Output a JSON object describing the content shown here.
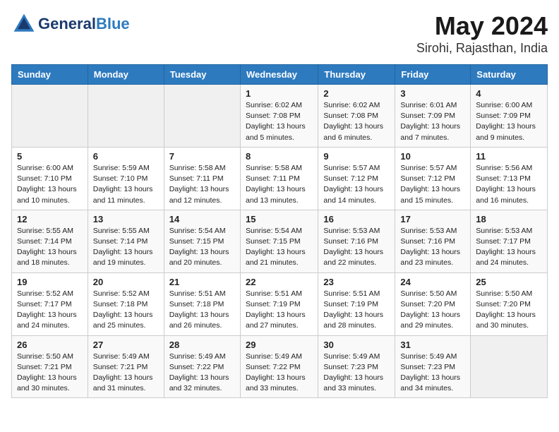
{
  "header": {
    "logo_general": "General",
    "logo_blue": "Blue",
    "month": "May 2024",
    "location": "Sirohi, Rajasthan, India"
  },
  "weekdays": [
    "Sunday",
    "Monday",
    "Tuesday",
    "Wednesday",
    "Thursday",
    "Friday",
    "Saturday"
  ],
  "weeks": [
    [
      {
        "day": "",
        "info": ""
      },
      {
        "day": "",
        "info": ""
      },
      {
        "day": "",
        "info": ""
      },
      {
        "day": "1",
        "info": "Sunrise: 6:02 AM\nSunset: 7:08 PM\nDaylight: 13 hours and 5 minutes."
      },
      {
        "day": "2",
        "info": "Sunrise: 6:02 AM\nSunset: 7:08 PM\nDaylight: 13 hours and 6 minutes."
      },
      {
        "day": "3",
        "info": "Sunrise: 6:01 AM\nSunset: 7:09 PM\nDaylight: 13 hours and 7 minutes."
      },
      {
        "day": "4",
        "info": "Sunrise: 6:00 AM\nSunset: 7:09 PM\nDaylight: 13 hours and 9 minutes."
      }
    ],
    [
      {
        "day": "5",
        "info": "Sunrise: 6:00 AM\nSunset: 7:10 PM\nDaylight: 13 hours and 10 minutes."
      },
      {
        "day": "6",
        "info": "Sunrise: 5:59 AM\nSunset: 7:10 PM\nDaylight: 13 hours and 11 minutes."
      },
      {
        "day": "7",
        "info": "Sunrise: 5:58 AM\nSunset: 7:11 PM\nDaylight: 13 hours and 12 minutes."
      },
      {
        "day": "8",
        "info": "Sunrise: 5:58 AM\nSunset: 7:11 PM\nDaylight: 13 hours and 13 minutes."
      },
      {
        "day": "9",
        "info": "Sunrise: 5:57 AM\nSunset: 7:12 PM\nDaylight: 13 hours and 14 minutes."
      },
      {
        "day": "10",
        "info": "Sunrise: 5:57 AM\nSunset: 7:12 PM\nDaylight: 13 hours and 15 minutes."
      },
      {
        "day": "11",
        "info": "Sunrise: 5:56 AM\nSunset: 7:13 PM\nDaylight: 13 hours and 16 minutes."
      }
    ],
    [
      {
        "day": "12",
        "info": "Sunrise: 5:55 AM\nSunset: 7:14 PM\nDaylight: 13 hours and 18 minutes."
      },
      {
        "day": "13",
        "info": "Sunrise: 5:55 AM\nSunset: 7:14 PM\nDaylight: 13 hours and 19 minutes."
      },
      {
        "day": "14",
        "info": "Sunrise: 5:54 AM\nSunset: 7:15 PM\nDaylight: 13 hours and 20 minutes."
      },
      {
        "day": "15",
        "info": "Sunrise: 5:54 AM\nSunset: 7:15 PM\nDaylight: 13 hours and 21 minutes."
      },
      {
        "day": "16",
        "info": "Sunrise: 5:53 AM\nSunset: 7:16 PM\nDaylight: 13 hours and 22 minutes."
      },
      {
        "day": "17",
        "info": "Sunrise: 5:53 AM\nSunset: 7:16 PM\nDaylight: 13 hours and 23 minutes."
      },
      {
        "day": "18",
        "info": "Sunrise: 5:53 AM\nSunset: 7:17 PM\nDaylight: 13 hours and 24 minutes."
      }
    ],
    [
      {
        "day": "19",
        "info": "Sunrise: 5:52 AM\nSunset: 7:17 PM\nDaylight: 13 hours and 24 minutes."
      },
      {
        "day": "20",
        "info": "Sunrise: 5:52 AM\nSunset: 7:18 PM\nDaylight: 13 hours and 25 minutes."
      },
      {
        "day": "21",
        "info": "Sunrise: 5:51 AM\nSunset: 7:18 PM\nDaylight: 13 hours and 26 minutes."
      },
      {
        "day": "22",
        "info": "Sunrise: 5:51 AM\nSunset: 7:19 PM\nDaylight: 13 hours and 27 minutes."
      },
      {
        "day": "23",
        "info": "Sunrise: 5:51 AM\nSunset: 7:19 PM\nDaylight: 13 hours and 28 minutes."
      },
      {
        "day": "24",
        "info": "Sunrise: 5:50 AM\nSunset: 7:20 PM\nDaylight: 13 hours and 29 minutes."
      },
      {
        "day": "25",
        "info": "Sunrise: 5:50 AM\nSunset: 7:20 PM\nDaylight: 13 hours and 30 minutes."
      }
    ],
    [
      {
        "day": "26",
        "info": "Sunrise: 5:50 AM\nSunset: 7:21 PM\nDaylight: 13 hours and 30 minutes."
      },
      {
        "day": "27",
        "info": "Sunrise: 5:49 AM\nSunset: 7:21 PM\nDaylight: 13 hours and 31 minutes."
      },
      {
        "day": "28",
        "info": "Sunrise: 5:49 AM\nSunset: 7:22 PM\nDaylight: 13 hours and 32 minutes."
      },
      {
        "day": "29",
        "info": "Sunrise: 5:49 AM\nSunset: 7:22 PM\nDaylight: 13 hours and 33 minutes."
      },
      {
        "day": "30",
        "info": "Sunrise: 5:49 AM\nSunset: 7:23 PM\nDaylight: 13 hours and 33 minutes."
      },
      {
        "day": "31",
        "info": "Sunrise: 5:49 AM\nSunset: 7:23 PM\nDaylight: 13 hours and 34 minutes."
      },
      {
        "day": "",
        "info": ""
      }
    ]
  ]
}
